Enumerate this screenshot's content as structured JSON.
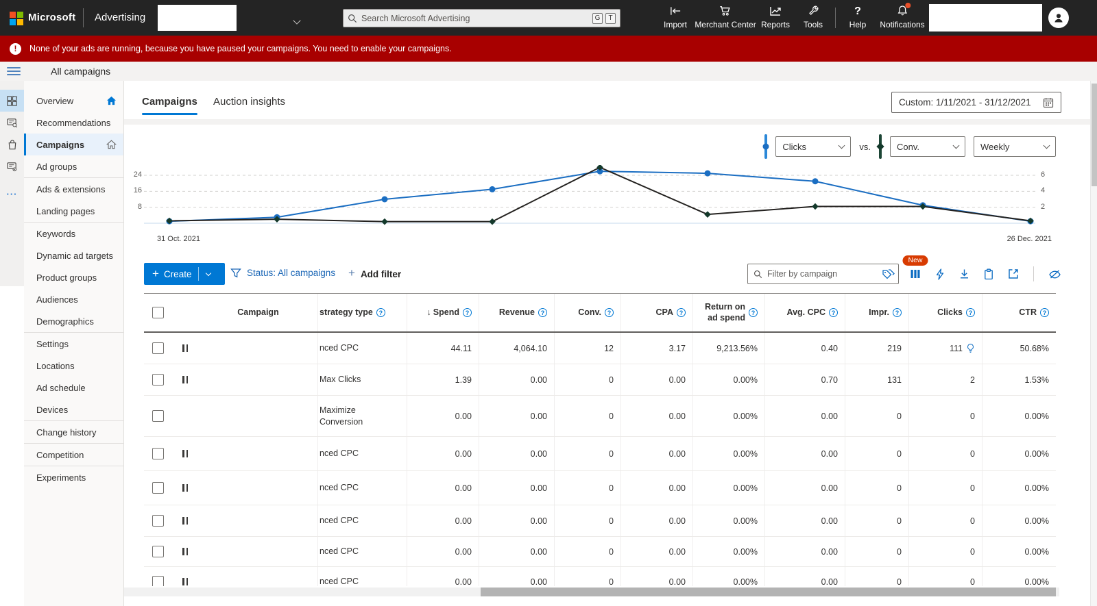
{
  "topbar": {
    "brand": "Microsoft",
    "product": "Advertising",
    "search": {
      "icon": "search-icon",
      "placeholder": "Search Microsoft Advertising",
      "keys": [
        "G",
        "T"
      ]
    },
    "actions": [
      {
        "label": "Import",
        "icon": "import-icon"
      },
      {
        "label": "Merchant Center",
        "icon": "merchant-center-cart-icon"
      },
      {
        "label": "Reports",
        "icon": "reports-chart-icon"
      },
      {
        "label": "Tools",
        "icon": "tools-wrench-icon"
      },
      {
        "label": "Help",
        "icon": "help-icon"
      },
      {
        "label": "Notifications",
        "icon": "notifications-bell-icon",
        "badge": true
      }
    ],
    "avatar_icon": "person-icon"
  },
  "banner": {
    "icon": "alert-icon",
    "text": "None of your ads are running, because you have paused your campaigns. You need to enable your campaigns."
  },
  "page_header": {
    "title": "All campaigns",
    "menu_icon": "hamburger-icon"
  },
  "sidebar": {
    "rail_icons": [
      "apps-grid-icon",
      "recommendations-chat-search-icon",
      "shopping-bag-icon",
      "ad-groups-chat-gear-icon",
      "more-ellipsis-icon"
    ],
    "items": [
      {
        "label": "Overview",
        "trailing_icon": "home-filled-icon"
      },
      {
        "label": "Recommendations"
      },
      {
        "label": "Campaigns",
        "selected": true,
        "trailing_icon": "home-outline-icon"
      },
      {
        "label": "Ad groups",
        "divider_after": true
      },
      {
        "label": "Ads & extensions"
      },
      {
        "label": "Landing pages",
        "divider_after": true
      },
      {
        "label": "Keywords"
      },
      {
        "label": "Dynamic ad targets"
      },
      {
        "label": "Product groups"
      },
      {
        "label": "Audiences"
      },
      {
        "label": "Demographics",
        "divider_after": true
      },
      {
        "label": "Settings"
      },
      {
        "label": "Locations"
      },
      {
        "label": "Ad schedule"
      },
      {
        "label": "Devices",
        "divider_after": true
      },
      {
        "label": "Change history",
        "divider_after": true
      },
      {
        "label": "Competition",
        "divider_after": true
      },
      {
        "label": "Experiments"
      }
    ]
  },
  "tabs": [
    {
      "label": "Campaigns",
      "selected": true
    },
    {
      "label": "Auction insights",
      "selected": false
    }
  ],
  "date_range": {
    "label": "Custom: 1/11/2021 - 31/12/2021",
    "icon": "calendar-icon"
  },
  "chart_controls": {
    "metric1": "Clicks",
    "vs_label": "vs.",
    "metric2": "Conv.",
    "granularity": "Weekly",
    "metric1_color": "#2b88d8",
    "metric2_color": "#1d4636"
  },
  "chart_data": {
    "type": "line",
    "x_start_label": "31 Oct. 2021",
    "x_end_label": "26 Dec. 2021",
    "left_axis_ticks": [
      24,
      16,
      8
    ],
    "right_axis_ticks": [
      6,
      4,
      2
    ],
    "grid": "dashed-horizontal",
    "legend_position": "controls-top-right",
    "series": [
      {
        "name": "Clicks",
        "axis": "left",
        "color": "#1b6ec2",
        "marker": "circle",
        "values": [
          1,
          3,
          12,
          17,
          26,
          25,
          21,
          9,
          1
        ]
      },
      {
        "name": "Conv.",
        "axis": "right",
        "color": "#242220",
        "marker": "diamond",
        "marker_color": "#14392b",
        "values": [
          0.3,
          0.5,
          0.2,
          0.2,
          7,
          1.1,
          2.1,
          2.1,
          0.3
        ]
      }
    ]
  },
  "toolbar": {
    "create_label": "Create",
    "status_filter_label": "Status: All campaigns",
    "filter_funnel_icon": "funnel-icon",
    "add_filter_label": "Add filter",
    "filter_placeholder": "Filter by campaign",
    "new_badge_label": "New",
    "icons": [
      "tags-icon",
      "columns-icon",
      "lightning-icon",
      "download-icon",
      "clipboard-icon",
      "expand-icon",
      "hide-chart-icon"
    ]
  },
  "table": {
    "columns": [
      {
        "label": "Campaign",
        "align": "center"
      },
      {
        "label": "strategy type",
        "align": "left",
        "help": true
      },
      {
        "label": "Spend",
        "align": "right",
        "help": true,
        "sort_desc": true
      },
      {
        "label": "Revenue",
        "align": "right",
        "help": true
      },
      {
        "label": "Conv.",
        "align": "right",
        "help": true
      },
      {
        "label": "CPA",
        "align": "right",
        "help": true
      },
      {
        "label": "Return on ad spend",
        "align": "right",
        "help": true
      },
      {
        "label": "Avg. CPC",
        "align": "right",
        "help": true
      },
      {
        "label": "Impr.",
        "align": "right",
        "help": true
      },
      {
        "label": "Clicks",
        "align": "right",
        "help": true
      },
      {
        "label": "CTR",
        "align": "right",
        "help": true
      }
    ],
    "rows": [
      {
        "paused": true,
        "campaign": "",
        "strategy": "nced CPC",
        "spend": "44.11",
        "revenue": "4,064.10",
        "conv": "12",
        "cpa": "3.17",
        "roas": "9,213.56%",
        "avg_cpc": "0.40",
        "impr": "219",
        "clicks": "111",
        "clicks_insight": true,
        "ctr": "50.68%"
      },
      {
        "paused": true,
        "campaign": "",
        "strategy": "Max Clicks",
        "spend": "1.39",
        "revenue": "0.00",
        "conv": "0",
        "cpa": "0.00",
        "roas": "0.00%",
        "avg_cpc": "0.70",
        "impr": "131",
        "clicks": "2",
        "ctr": "1.53%"
      },
      {
        "paused": false,
        "campaign": "",
        "strategy": "Maximize Conversion",
        "spend": "0.00",
        "revenue": "0.00",
        "conv": "0",
        "cpa": "0.00",
        "roas": "0.00%",
        "avg_cpc": "0.00",
        "impr": "0",
        "clicks": "0",
        "ctr": "0.00%"
      },
      {
        "paused": true,
        "campaign": "",
        "strategy": "nced CPC",
        "spend": "0.00",
        "revenue": "0.00",
        "conv": "0",
        "cpa": "0.00",
        "roas": "0.00%",
        "avg_cpc": "0.00",
        "impr": "0",
        "clicks": "0",
        "ctr": "0.00%"
      },
      {
        "paused": true,
        "campaign": "",
        "strategy": "nced CPC",
        "spend": "0.00",
        "revenue": "0.00",
        "conv": "0",
        "cpa": "0.00",
        "roas": "0.00%",
        "avg_cpc": "0.00",
        "impr": "0",
        "clicks": "0",
        "ctr": "0.00%"
      },
      {
        "paused": true,
        "campaign": "",
        "strategy": "nced CPC",
        "spend": "0.00",
        "revenue": "0.00",
        "conv": "0",
        "cpa": "0.00",
        "roas": "0.00%",
        "avg_cpc": "0.00",
        "impr": "0",
        "clicks": "0",
        "ctr": "0.00%"
      },
      {
        "paused": true,
        "campaign": "",
        "strategy": "nced CPC",
        "spend": "0.00",
        "revenue": "0.00",
        "conv": "0",
        "cpa": "0.00",
        "roas": "0.00%",
        "avg_cpc": "0.00",
        "impr": "0",
        "clicks": "0",
        "ctr": "0.00%"
      },
      {
        "paused": true,
        "campaign": "",
        "strategy": "nced CPC",
        "spend": "0.00",
        "revenue": "0.00",
        "conv": "0",
        "cpa": "0.00",
        "roas": "0.00%",
        "avg_cpc": "0.00",
        "impr": "0",
        "clicks": "0",
        "ctr": "0.00%"
      }
    ]
  }
}
